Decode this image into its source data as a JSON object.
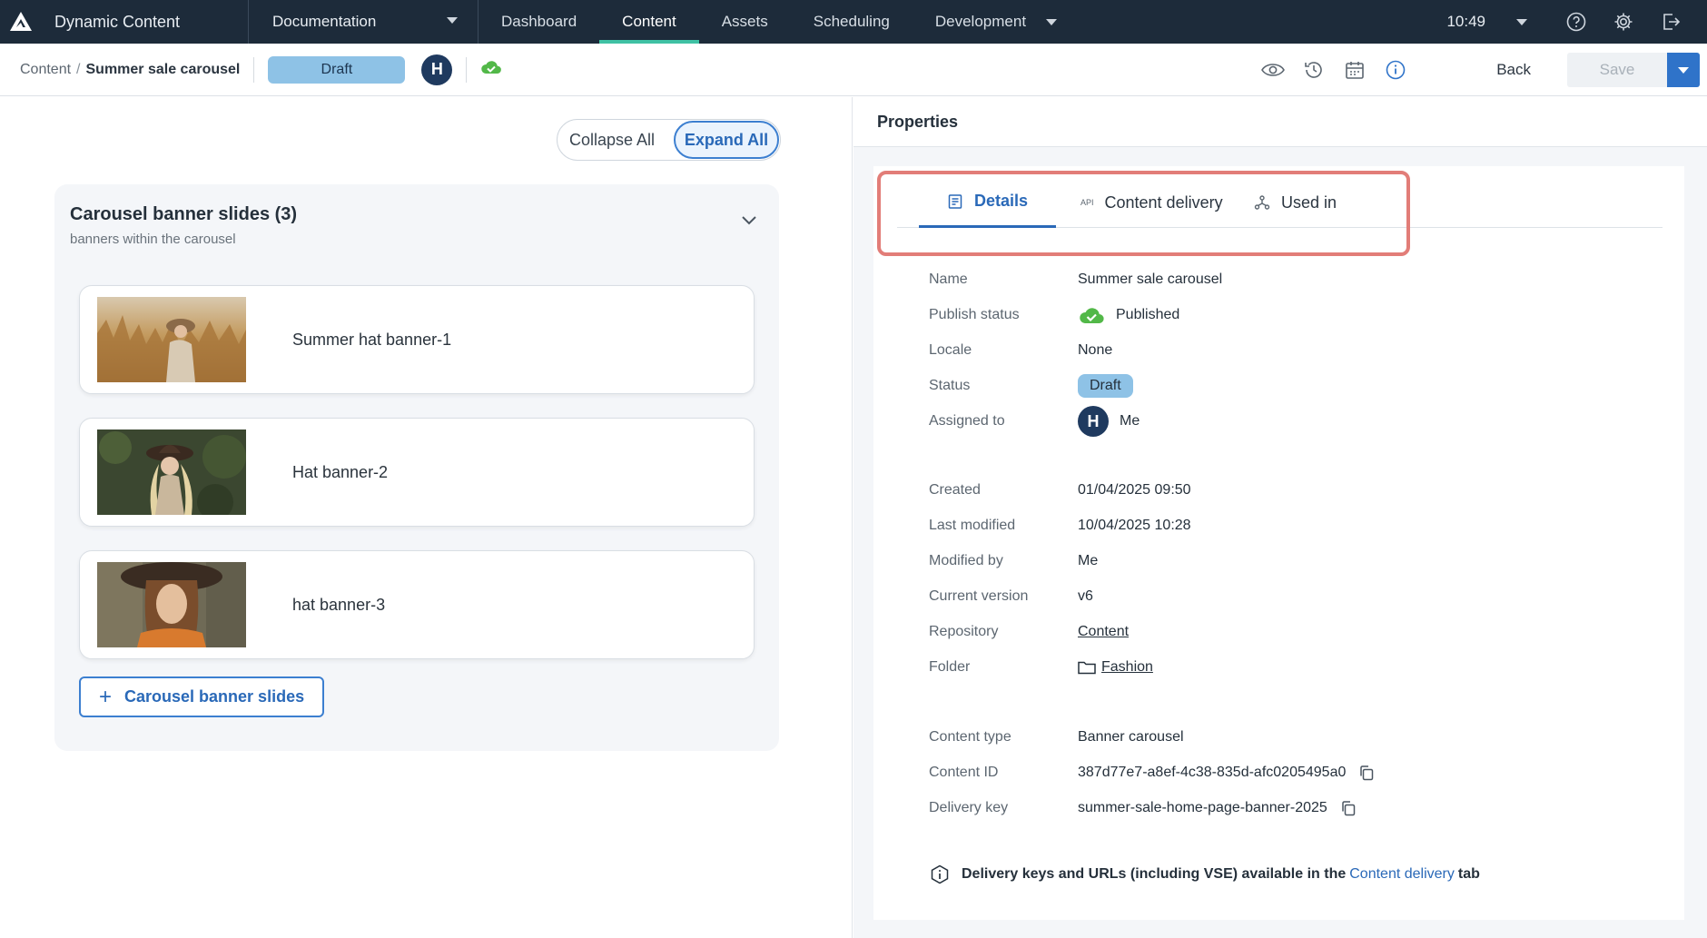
{
  "topnav": {
    "app_name": "Dynamic Content",
    "hub_selector": "Documentation",
    "tabs": [
      {
        "label": "Dashboard"
      },
      {
        "label": "Content"
      },
      {
        "label": "Assets"
      },
      {
        "label": "Scheduling"
      },
      {
        "label": "Development"
      }
    ],
    "active_tab": "Content",
    "time": "10:49",
    "accent_color": "#3fc1a4"
  },
  "toolbar": {
    "breadcrumb_root": "Content",
    "breadcrumb_sep": "/",
    "breadcrumb_current": "Summer sale carousel",
    "status_label": "Draft",
    "avatar_initial": "H",
    "back_label": "Back",
    "save_label": "Save"
  },
  "editor": {
    "collapse_all_label": "Collapse All",
    "expand_all_label": "Expand All",
    "section_title": "Carousel banner slides (3)",
    "section_subtitle": "banners within the carousel",
    "slides": [
      {
        "label": "Summer hat banner-1"
      },
      {
        "label": "Hat banner-2"
      },
      {
        "label": "hat banner-3"
      }
    ],
    "add_button_label": "Carousel banner slides"
  },
  "properties": {
    "header": "Properties",
    "tabs": [
      {
        "label": "Details",
        "icon": "details-icon"
      },
      {
        "label": "Content delivery",
        "icon": "api-icon",
        "icon_text": "API"
      },
      {
        "label": "Used in",
        "icon": "hierarchy-icon"
      }
    ],
    "active_tab": "Details",
    "fields": {
      "name": {
        "label": "Name",
        "value": "Summer sale carousel"
      },
      "publish_status": {
        "label": "Publish status",
        "value": "Published"
      },
      "locale": {
        "label": "Locale",
        "value": "None"
      },
      "status": {
        "label": "Status",
        "value": "Draft"
      },
      "assigned_to": {
        "label": "Assigned to",
        "initial": "H",
        "value": "Me"
      },
      "created": {
        "label": "Created",
        "value": "01/04/2025 09:50"
      },
      "last_modified": {
        "label": "Last modified",
        "value": "10/04/2025 10:28"
      },
      "modified_by": {
        "label": "Modified by",
        "value": "Me"
      },
      "current_version": {
        "label": "Current version",
        "value": "v6"
      },
      "repository": {
        "label": "Repository",
        "value": "Content"
      },
      "folder": {
        "label": "Folder",
        "value": "Fashion"
      },
      "content_type": {
        "label": "Content type",
        "value": "Banner carousel"
      },
      "content_id": {
        "label": "Content ID",
        "value": "387d77e7-a8ef-4c38-835d-afc0205495a0"
      },
      "delivery_key": {
        "label": "Delivery key",
        "value": "summer-sale-home-page-banner-2025"
      }
    },
    "note": {
      "prefix": "Delivery keys and URLs (including VSE) available in the",
      "link": "Content delivery",
      "suffix": "tab"
    },
    "highlight_color": "#e27d78"
  }
}
